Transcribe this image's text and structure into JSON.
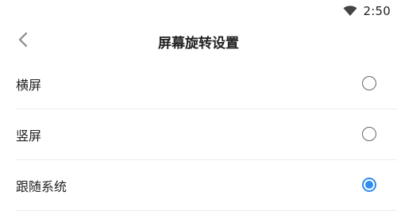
{
  "status_bar": {
    "time": "2:50",
    "wifi_icon": "wifi-icon"
  },
  "header": {
    "back_icon": "chevron-left-icon",
    "title": "屏幕旋转设置"
  },
  "options": [
    {
      "label": "横屏",
      "selected": false
    },
    {
      "label": "竖屏",
      "selected": false
    },
    {
      "label": "跟随系统",
      "selected": true
    }
  ],
  "colors": {
    "accent": "#2f8cf0",
    "radio_border": "#666666",
    "divider": "#ececec",
    "back_icon": "#8a8a8a"
  }
}
